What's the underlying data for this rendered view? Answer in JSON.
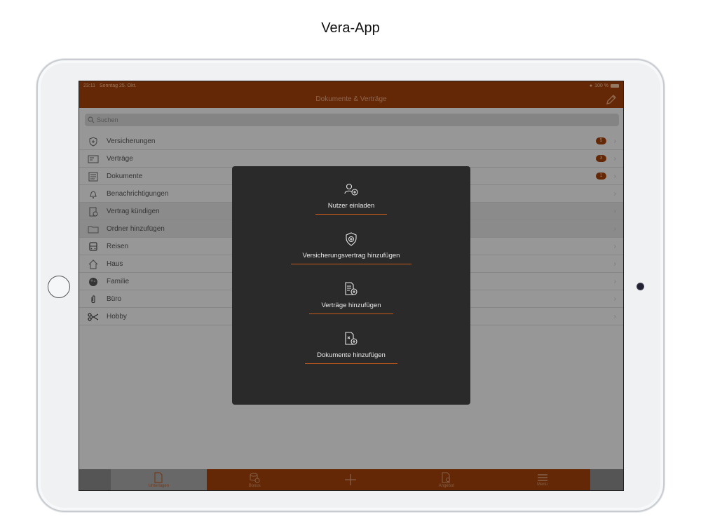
{
  "page_title": "Vera-App",
  "status_bar": {
    "time": "23:11",
    "date": "Sonntag 25. Okt.",
    "battery": "100 %"
  },
  "nav": {
    "title": "Dokumente & Verträge"
  },
  "search": {
    "placeholder": "Suchen"
  },
  "list": [
    {
      "label": "Versicherungen",
      "icon": "shield-icon",
      "badge": "5",
      "highlight": false
    },
    {
      "label": "Verträge",
      "icon": "contract-icon",
      "badge": "3",
      "highlight": false
    },
    {
      "label": "Dokumente",
      "icon": "documents-icon",
      "badge": "1",
      "highlight": false
    },
    {
      "label": "Benachrichtigungen",
      "icon": "bell-icon",
      "badge": "",
      "highlight": false
    },
    {
      "label": "Vertrag kündigen",
      "icon": "cancel-contract-icon",
      "badge": "",
      "highlight": true
    },
    {
      "label": "Ordner hinzufügen",
      "icon": "folder-icon",
      "badge": "",
      "highlight": true
    },
    {
      "label": "Reisen",
      "icon": "bus-icon",
      "badge": "",
      "highlight": false
    },
    {
      "label": "Haus",
      "icon": "house-icon",
      "badge": "",
      "highlight": false
    },
    {
      "label": "Familie",
      "icon": "family-icon",
      "badge": "",
      "highlight": false
    },
    {
      "label": "Büro",
      "icon": "paperclip-icon",
      "badge": "",
      "highlight": false
    },
    {
      "label": "Hobby",
      "icon": "scissors-icon",
      "badge": "",
      "highlight": false
    }
  ],
  "tabs": [
    {
      "label": "Unterlagen",
      "icon": "document-icon",
      "active": true
    },
    {
      "label": "Bonus",
      "icon": "coins-icon",
      "active": false
    },
    {
      "label": "",
      "icon": "plus-icon",
      "active": false
    },
    {
      "label": "Angebot",
      "icon": "search-document-icon",
      "active": false
    },
    {
      "label": "Menü",
      "icon": "menu-icon",
      "active": false
    }
  ],
  "modal": {
    "actions": [
      {
        "label": "Nutzer einladen",
        "icon": "invite-user-icon"
      },
      {
        "label": "Versicherungsvertrag hinzufügen",
        "icon": "shield-plus-icon"
      },
      {
        "label": "Verträge hinzufügen",
        "icon": "contract-add-icon"
      },
      {
        "label": "Dokumente hinzufügen",
        "icon": "document-add-icon"
      }
    ]
  },
  "colors": {
    "accent": "#a3420a",
    "modal_bg": "#2a2a2b",
    "underline": "#c85a1a"
  }
}
